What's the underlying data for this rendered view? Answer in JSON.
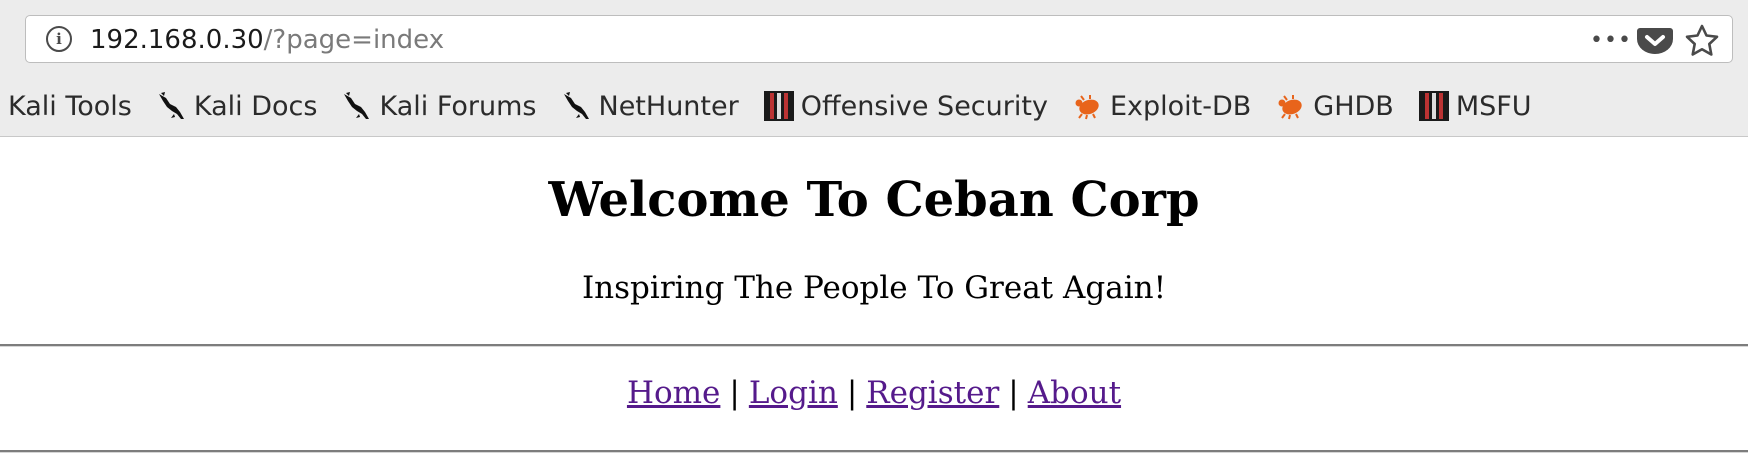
{
  "browser": {
    "url_host": "192.168.0.30",
    "url_path": "/?page=index",
    "bookmarks": [
      {
        "label": "Kali Tools",
        "icon": "none"
      },
      {
        "label": "Kali Docs",
        "icon": "kali-dragon-icon"
      },
      {
        "label": "Kali Forums",
        "icon": "kali-dragon-icon"
      },
      {
        "label": "NetHunter",
        "icon": "kali-dragon-icon"
      },
      {
        "label": "Offensive Security",
        "icon": "offsec-icon"
      },
      {
        "label": "Exploit-DB",
        "icon": "exploitdb-bug-icon"
      },
      {
        "label": "GHDB",
        "icon": "exploitdb-bug-icon"
      },
      {
        "label": "MSFU",
        "icon": "offsec-icon"
      }
    ]
  },
  "page": {
    "title": "Welcome To Ceban Corp",
    "tagline": "Inspiring The People To Great Again!",
    "nav": [
      {
        "label": "Home"
      },
      {
        "label": "Login"
      },
      {
        "label": "Register"
      },
      {
        "label": "About"
      }
    ],
    "nav_separator": "|"
  },
  "colors": {
    "visited_link": "#551a8b",
    "pocket": "#4a4a4a",
    "exploitdb_orange": "#e8641b"
  }
}
